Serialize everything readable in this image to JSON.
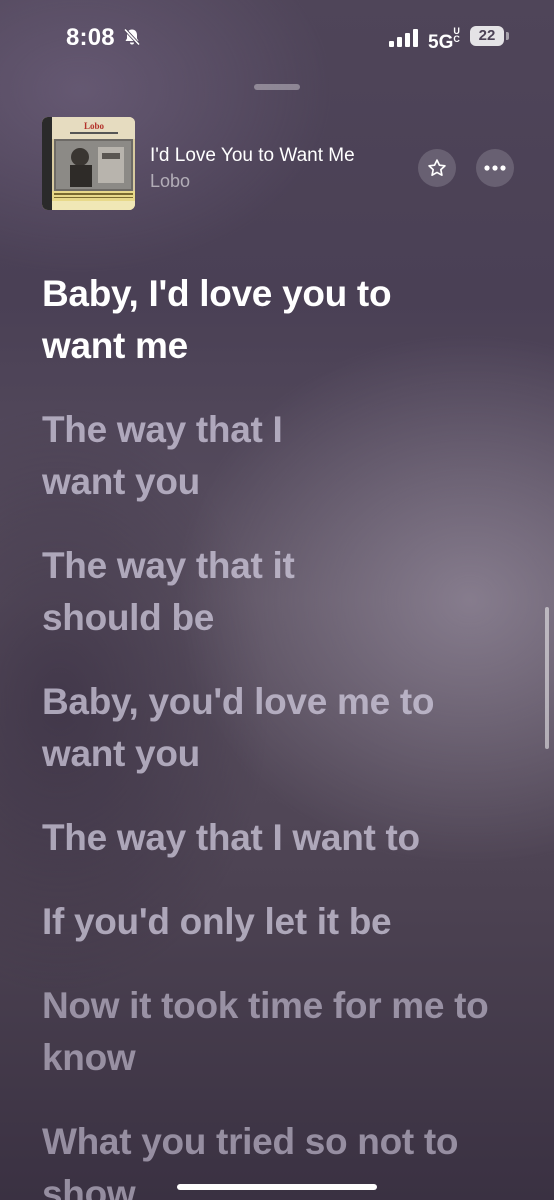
{
  "status_bar": {
    "time": "8:08",
    "network": "5G",
    "network_sup": "UC",
    "battery": "22",
    "icons": [
      "bell-off-icon",
      "signal-icon"
    ]
  },
  "now_playing": {
    "title": "I'd Love You to Want Me",
    "artist": "Lobo",
    "album_art_text": "Lobo",
    "icons": [
      "star-icon",
      "more-icon"
    ]
  },
  "lyrics": {
    "lines": [
      "Baby, I'd love you to want me",
      "The way that I want you",
      "The way that it should be",
      "Baby, you'd love me to want you",
      "The way that I want to",
      "If you'd only let it be",
      "Now it took time for me to know",
      "What you tried so not to show"
    ],
    "active_index": 0
  },
  "colors": {
    "background": "#4f4559",
    "active_lyric": "#ffffff",
    "inactive_lyric": "#d4cee2"
  }
}
